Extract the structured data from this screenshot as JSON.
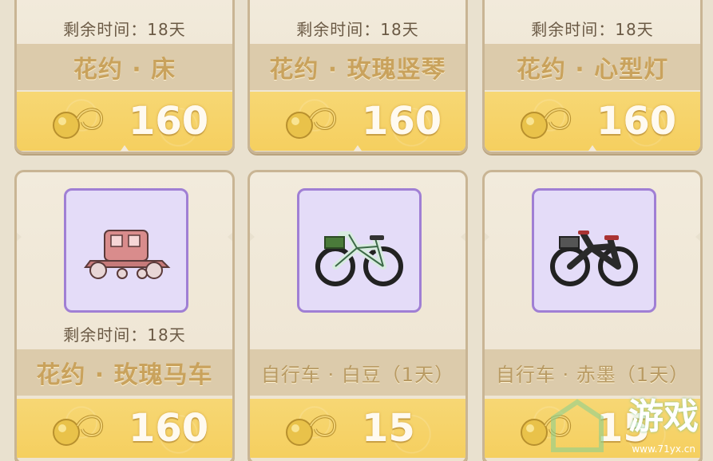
{
  "cards": [
    {
      "time": "剩余时间：18天",
      "name": "花约 · 床",
      "price": "160"
    },
    {
      "time": "剩余时间：18天",
      "name": "花约 · 玫瑰竖琴",
      "price": "160"
    },
    {
      "time": "剩余时间：18天",
      "name": "花约 · 心型灯",
      "price": "160"
    },
    {
      "time": "剩余时间：18天",
      "name": "花约 · 玫瑰马车",
      "price": "160",
      "icon": "carriage-icon"
    },
    {
      "time": "",
      "name": "自行车 · 白豆（1天）",
      "price": "15",
      "icon": "bicycle-white-icon"
    },
    {
      "time": "",
      "name": "自行车 · 赤墨（1天）",
      "price": "15",
      "icon": "bicycle-black-icon"
    }
  ],
  "watermark": {
    "text": "游戏",
    "url": "www.71yx.cn"
  },
  "colors": {
    "price_band": "#f5cf5f",
    "thumb_bg": "#e4dcf8",
    "thumb_border": "#a07fd4",
    "name_text": "#c9a25c"
  }
}
